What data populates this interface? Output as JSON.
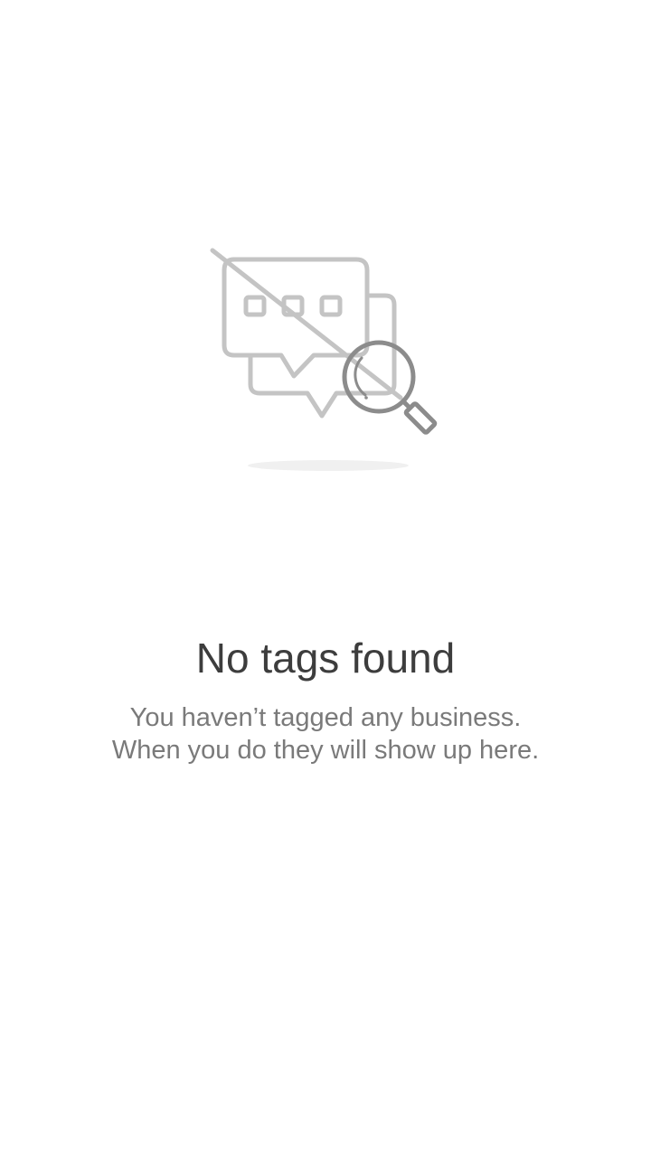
{
  "empty_state": {
    "illustration_icon": "no-results-chat-search-icon",
    "title": "No tags found",
    "message_line_1": "You haven’t tagged any business.",
    "message_line_2": "When you do they will show up here.",
    "colors": {
      "illustration_light": "#c4c4c4",
      "illustration_dark": "#8c8c8c",
      "title": "#3d3d3d",
      "message": "#7a7a7a"
    }
  }
}
